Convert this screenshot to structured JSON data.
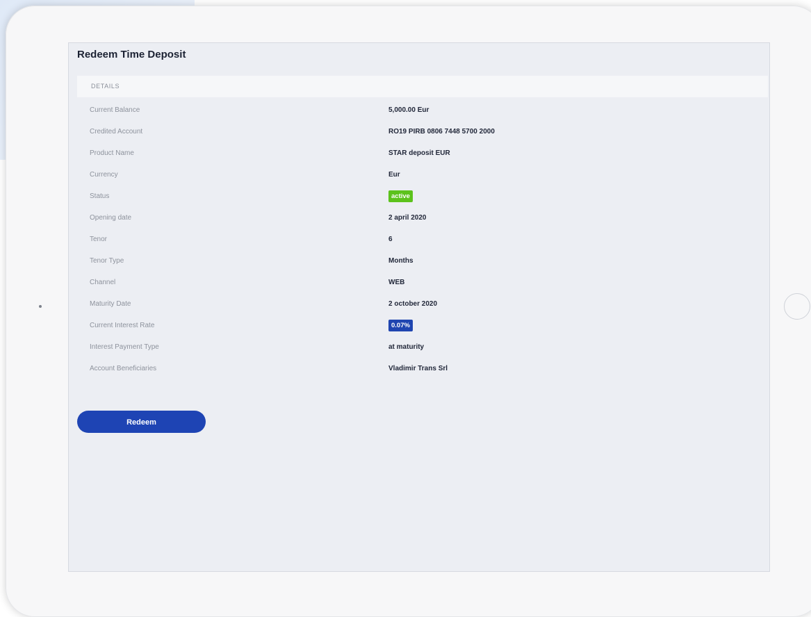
{
  "page": {
    "title": "Redeem Time Deposit",
    "section_title": "DETAILS"
  },
  "details": [
    {
      "label": "Current Balance",
      "value": "5,000.00 Eur"
    },
    {
      "label": "Credited Account",
      "value": "RO19 PIRB 0806 7448 5700 2000"
    },
    {
      "label": "Product Name",
      "value": "STAR deposit EUR"
    },
    {
      "label": "Currency",
      "value": "Eur"
    },
    {
      "label": "Status",
      "value": "active",
      "badge_color": "#5cc21c"
    },
    {
      "label": "Opening date",
      "value": "2 april 2020"
    },
    {
      "label": "Tenor",
      "value": "6"
    },
    {
      "label": "Tenor Type",
      "value": "Months"
    },
    {
      "label": "Channel",
      "value": "WEB"
    },
    {
      "label": "Maturity Date",
      "value": "2 october 2020"
    },
    {
      "label": "Current Interest Rate",
      "value": "0.07%",
      "badge_color": "#1f45b0"
    },
    {
      "label": "Interest Payment Type",
      "value": "at maturity"
    },
    {
      "label": "Account Beneficiaries",
      "value": "Vladimir Trans Srl"
    }
  ],
  "actions": {
    "redeem_label": "Redeem"
  },
  "colors": {
    "accent": "#1e44b4",
    "status_active": "#5cc21c",
    "screen_background": "#eceef3"
  }
}
